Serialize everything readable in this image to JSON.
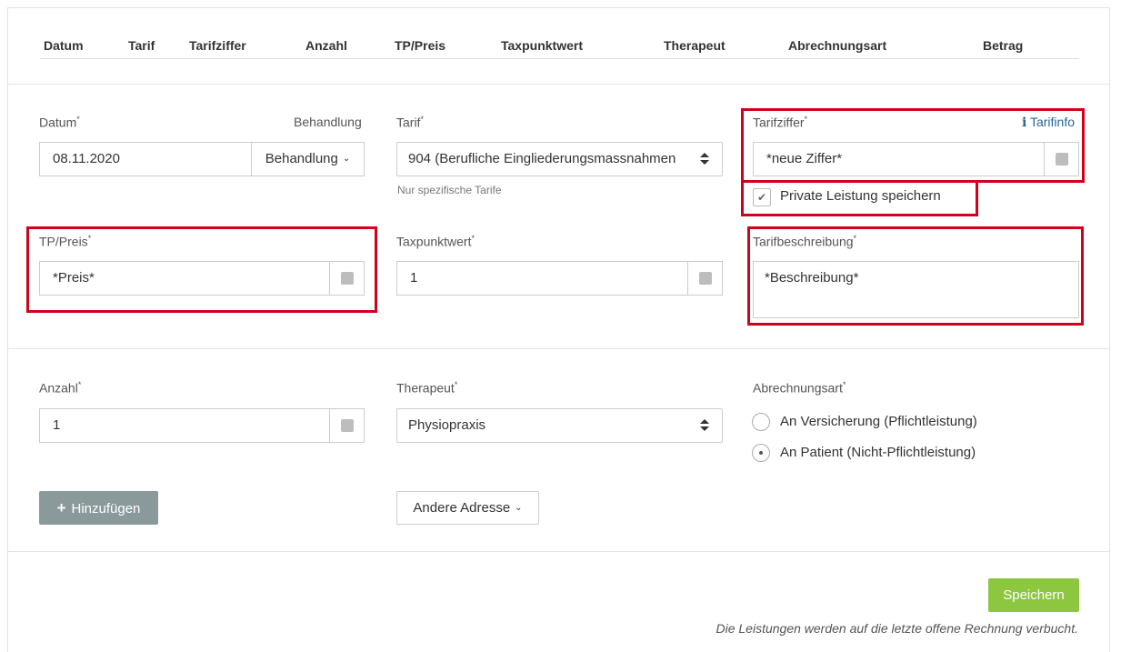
{
  "columns": [
    "Datum",
    "Tarif",
    "Tarifziffer",
    "Anzahl",
    "TP/Preis",
    "Taxpunktwert",
    "Therapeut",
    "Abrechnungsart",
    "Betrag"
  ],
  "form": {
    "datum": {
      "label": "Datum",
      "value": "08.11.2020"
    },
    "behandlung": {
      "label": "Behandlung",
      "value": "Behandlung"
    },
    "tarif": {
      "label": "Tarif",
      "value": "904 (Berufliche Eingliederungsmassnahmen",
      "hint": "Nur spezifische Tarife"
    },
    "tarifziffer": {
      "label": "Tarifziffer",
      "value": "*neue Ziffer*",
      "info_link": "Tarifinfo",
      "info_icon": "info-icon"
    },
    "private_leistung": {
      "label": "Private Leistung speichern",
      "checked": true
    },
    "tp_preis": {
      "label": "TP/Preis",
      "value": "*Preis*"
    },
    "taxpunktwert": {
      "label": "Taxpunktwert",
      "value": "1"
    },
    "tarifbeschreibung": {
      "label": "Tarifbeschreibung",
      "value": "*Beschreibung*"
    },
    "anzahl": {
      "label": "Anzahl",
      "value": "1"
    },
    "therapeut": {
      "label": "Therapeut",
      "value": "Physiopraxis"
    },
    "abrechnungsart": {
      "label": "Abrechnungsart",
      "options": [
        {
          "label": "An Versicherung (Pflichtleistung)",
          "selected": false
        },
        {
          "label": "An Patient (Nicht-Pflichtleistung)",
          "selected": true
        }
      ]
    }
  },
  "buttons": {
    "add": "Hinzufügen",
    "other_address": "Andere Adresse",
    "save": "Speichern"
  },
  "footer_note": "Die Leistungen werden auf die letzte offene Rechnung verbucht.",
  "required_mark": "*",
  "colors": {
    "highlight_red": "#d0021b",
    "save_green": "#8dc63f",
    "add_gray": "#8a9a9a",
    "link_blue": "#2a6496"
  }
}
